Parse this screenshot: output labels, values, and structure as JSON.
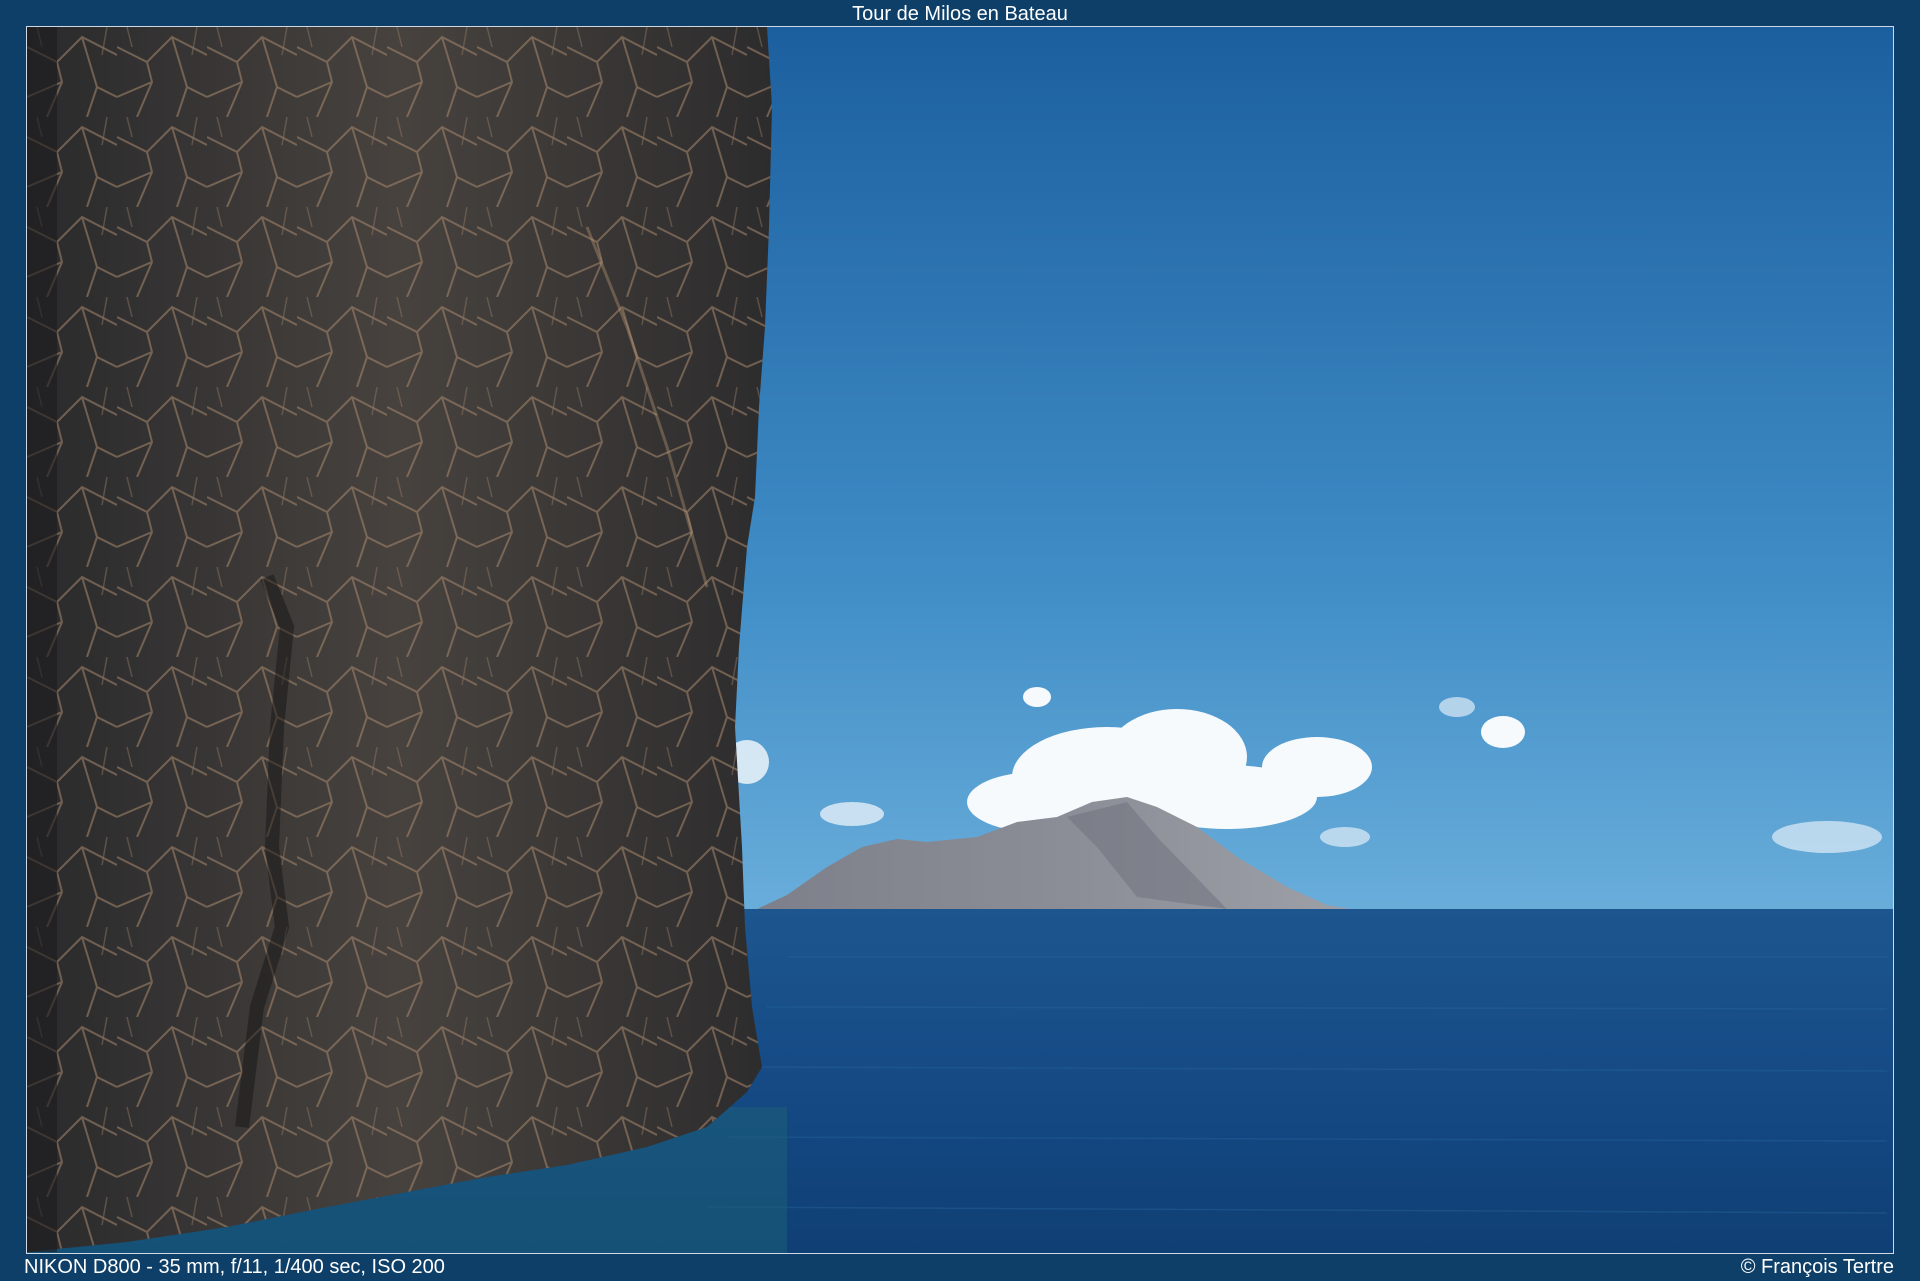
{
  "header": {
    "title": "Tour de Milos en Bateau"
  },
  "photo": {
    "subject": "sea-cliff-and-island",
    "colors": {
      "frame_background": "#0e3f68",
      "sky_top": "#1c5f9f",
      "sky_horizon": "#6cb0dc",
      "sea": "#154a85",
      "rock": "#3b3a3a",
      "island": "#8b8d96"
    }
  },
  "footer": {
    "exif": "NIKON D800 - 35 mm, f/11, 1/400 sec, ISO 200",
    "copyright": "© François Tertre"
  }
}
